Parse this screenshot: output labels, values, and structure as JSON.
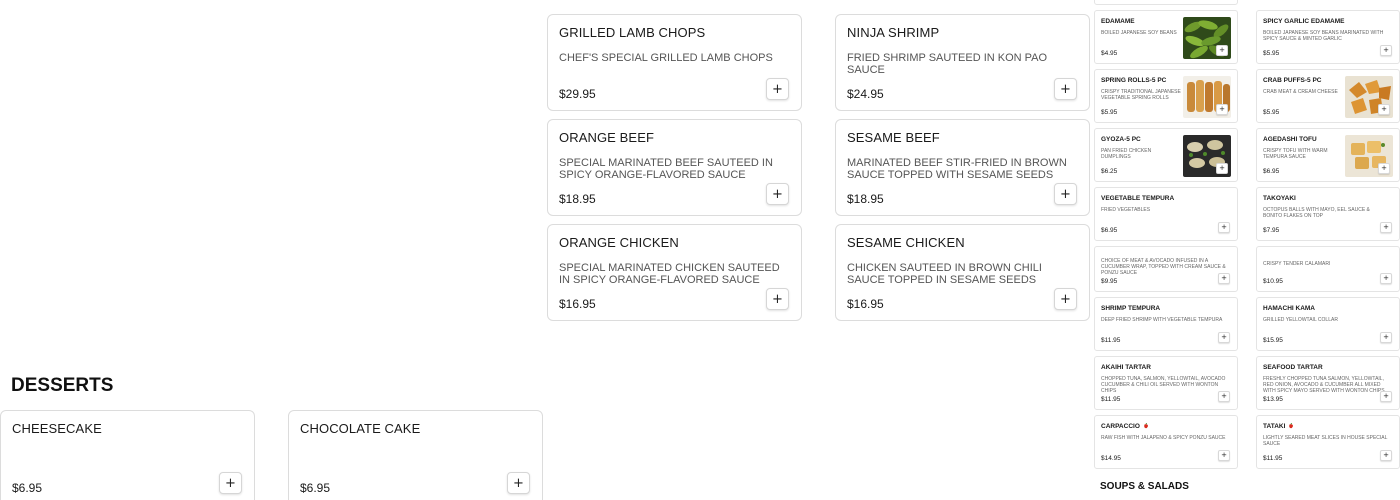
{
  "colors": {
    "card_border": "#dcdcdc",
    "text": "#1a1a1a",
    "muted": "#555555"
  },
  "main_items": [
    {
      "name": "GRILLED LAMB CHOPS",
      "desc": "CHEF'S SPECIAL GRILLED LAMB CHOPS",
      "price": "$29.95"
    },
    {
      "name": "NINJA SHRIMP",
      "desc": "FRIED SHRIMP SAUTEED IN KON PAO SAUCE",
      "price": "$24.95"
    },
    {
      "name": "ORANGE BEEF",
      "desc": "SPECIAL MARINATED BEEF SAUTEED IN SPICY ORANGE-FLAVORED SAUCE",
      "price": "$18.95"
    },
    {
      "name": "SESAME BEEF",
      "desc": "MARINATED BEEF STIR-FRIED IN BROWN SAUCE TOPPED WITH SESAME SEEDS",
      "price": "$18.95"
    },
    {
      "name": "ORANGE CHICKEN",
      "desc": "SPECIAL MARINATED CHICKEN SAUTEED IN SPICY ORANGE-FLAVORED SAUCE",
      "price": "$16.95"
    },
    {
      "name": "SESAME CHICKEN",
      "desc": "CHICKEN SAUTEED IN BROWN CHILI SAUCE TOPPED IN SESAME SEEDS",
      "price": "$16.95"
    }
  ],
  "desserts": {
    "title": "DESSERTS",
    "items": [
      {
        "name": "CHEESECAKE",
        "price": "$6.95"
      },
      {
        "name": "CHOCOLATE CAKE",
        "price": "$6.95"
      }
    ]
  },
  "add_label": "+",
  "side_items": [
    {
      "name": "EDAMAME",
      "desc": "BOILED JAPANESE SOY BEANS",
      "price": "$4.95",
      "image": "edamame"
    },
    {
      "name": "SPICY GARLIC EDAMAME",
      "desc": "BOILED JAPANESE SOY BEANS MARINATED WITH SPICY SAUCE & MINTED GARLIC",
      "price": "$5.95"
    },
    {
      "name": "SPRING ROLLS-5 PC",
      "desc": "CRISPY TRADITIONAL JAPANESE VEGETABLE SPRING ROLLS",
      "price": "$5.95",
      "image": "spring-rolls"
    },
    {
      "name": "CRAB PUFFS-5 PC",
      "desc": "CRAB MEAT & CREAM CHEESE",
      "price": "$5.95",
      "image": "crab-puffs"
    },
    {
      "name": "GYOZA-5 PC",
      "desc": "PAN FRIED CHICKEN DUMPLINGS",
      "price": "$6.25",
      "image": "gyoza"
    },
    {
      "name": "AGEDASHI TOFU",
      "desc": "CRISPY TOFU WITH WARM TEMPURA SAUCE",
      "price": "$6.95",
      "image": "tofu"
    },
    {
      "name": "VEGETABLE TEMPURA",
      "desc": "FRIED VEGETABLES",
      "price": "$6.95"
    },
    {
      "name": "TAKOYAKI",
      "desc": "OCTOPUS BALLS WITH MAYO, EEL SAUCE & BONITO FLAKES ON TOP",
      "price": "$7.95"
    },
    {
      "name": "",
      "desc": "CHOICE OF MEAT & AVOCADO INFUSED IN A CUCUMBER WRAP, TOPPED WITH CREAM SAUCE & PONZU SAUCE",
      "price": "$9.95"
    },
    {
      "name": "",
      "desc": "CRISPY TENDER CALAMARI",
      "price": "$10.95"
    },
    {
      "name": "SHRIMP TEMPURA",
      "desc": "DEEP FRIED SHRIMP WITH VEGETABLE TEMPURA",
      "price": "$11.95"
    },
    {
      "name": "HAMACHI KAMA",
      "desc": "GRILLED YELLOWTAIL COLLAR",
      "price": "$15.95"
    },
    {
      "name": "AKAIHI TARTAR",
      "desc": "CHOPPED TUNA, SALMON, YELLOWTAIL, AVOCADO CUCUMBER & CHILI OIL SERVED WITH WONTON CHIPS",
      "price": "$11.95"
    },
    {
      "name": "SEAFOOD TARTAR",
      "desc": "FRESHLY CHOPPED TUNA SALMON, YELLOWTAIL, RED ONION, AVOCADO & CUCUMBER ALL MIXED WITH SPICY MAYO SERVED WITH WONTON CHIPS",
      "price": "$13.95"
    },
    {
      "name": "CARPACCIO",
      "desc": "RAW FISH WITH JALAPENO & SPICY PONZU SAUCE",
      "price": "$14.95",
      "spicy": true
    },
    {
      "name": "TATAKI",
      "desc": "LIGHTLY SEARED MEAT SLICES IN HOUSE SPECIAL SAUCE",
      "price": "$11.95",
      "spicy": true
    }
  ],
  "soups_title": "SOUPS & SALADS",
  "spicy_icon": "chili-pepper-icon"
}
